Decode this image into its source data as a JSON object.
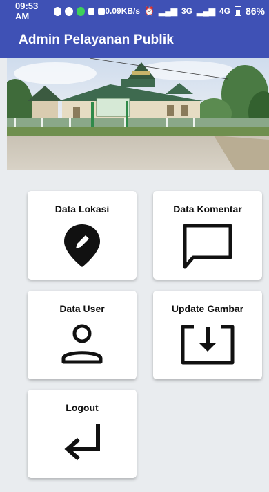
{
  "status_bar": {
    "time": "09:53 AM",
    "network_speed": "0.09KB/s",
    "signal_3g": "3G",
    "signal_4g": "4G",
    "battery": "86%"
  },
  "app_bar": {
    "title": "Admin Pelayanan Publik"
  },
  "menu": {
    "data_lokasi": "Data Lokasi",
    "data_komentar": "Data Komentar",
    "data_user": "Data User",
    "update_gambar": "Update Gambar",
    "logout": "Logout"
  },
  "icons": {
    "data_lokasi": "location-edit-icon",
    "data_komentar": "comment-icon",
    "data_user": "user-icon",
    "update_gambar": "download-icon",
    "logout": "enter-return-icon"
  },
  "colors": {
    "primary": "#3f51b5",
    "background": "#e9ecef"
  }
}
